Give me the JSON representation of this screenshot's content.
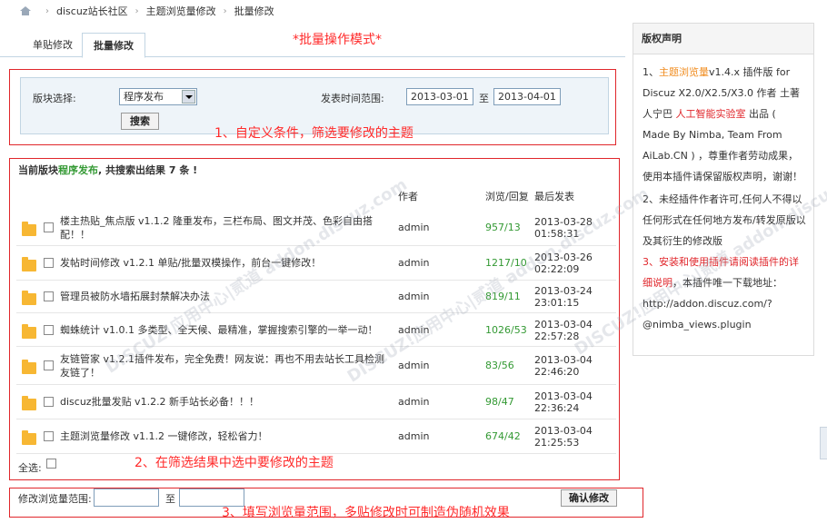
{
  "breadcrumb": [
    "discuz站长社区",
    "主题浏览量修改",
    "批量修改"
  ],
  "tabs": [
    "单贴修改",
    "批量修改"
  ],
  "mode_title": "*批量操作模式*",
  "filter": {
    "forum_label": "版块选择:",
    "forum_value": "程序发布",
    "date_label": "发表时间范围:",
    "date_from": "2013-03-01",
    "date_sep": "至",
    "date_to": "2013-04-01",
    "search_btn": "搜索"
  },
  "annotations": {
    "a1": "1、自定义条件，筛选要修改的主题",
    "a2": "2、在筛选结果中选中要修改的主题",
    "a3": "3、填写浏览量范围，多贴修改时可制造伪随机效果"
  },
  "results": {
    "prefix": "当前版块",
    "forum": "程序发布",
    "mid": ", 共搜索出结果 ",
    "count": "7",
    "suffix": " 条 !"
  },
  "columns": {
    "author": "作者",
    "stats": "浏览/回复",
    "last": "最后发表"
  },
  "rows": [
    {
      "title": "楼主热贴_焦点版 v1.1.2 隆重发布，三栏布局、图文并茂、色彩自由搭配！！",
      "author": "admin",
      "stats": "957/13",
      "date": "2013-03-28",
      "time": "01:58:31"
    },
    {
      "title": "发帖时间修改 v1.2.1 单贴/批量双模操作，前台一键修改！",
      "author": "admin",
      "stats": "1217/10",
      "date": "2013-03-26",
      "time": "02:22:09"
    },
    {
      "title": "管理员被防水墙拓展封禁解决办法",
      "author": "admin",
      "stats": "819/11",
      "date": "2013-03-24",
      "time": "23:01:15"
    },
    {
      "title": "蜘蛛统计 v1.0.1 多类型、全天候、最精准，掌握搜索引擎的一举一动！",
      "author": "admin",
      "stats": "1026/53",
      "date": "2013-03-04",
      "time": "22:57:28"
    },
    {
      "title": "友链管家 v1.2.1插件发布，完全免费！网友说：再也不用去站长工具检测友链了！",
      "author": "admin",
      "stats": "83/56",
      "date": "2013-03-04",
      "time": "22:46:20"
    },
    {
      "title": "discuz批量发贴 v1.2.2 新手站长必备！！！",
      "author": "admin",
      "stats": "98/47",
      "date": "2013-03-04",
      "time": "22:36:24"
    },
    {
      "title": "主题浏览量修改 v1.1.2 一键修改，轻松省力！",
      "author": "admin",
      "stats": "674/42",
      "date": "2013-03-04",
      "time": "21:25:53"
    }
  ],
  "select_all": "全选:",
  "views_range": {
    "label": "修改浏览量范围:",
    "sep": "至",
    "confirm_btn": "确认修改"
  },
  "sidebar": {
    "title": "版权声明",
    "p1_a": "1、",
    "p1_link": "主题浏览量",
    "p1_b": "v1.4.x 插件版 for Discuz X2.0/X2.5/X3.0 作者 土著人宁巴 ",
    "p1_lab": "人工智能实验室",
    "p1_c": " 出品 ( Made By Nimba, Team From AiLab.CN ) ，尊重作者劳动成果，使用本插件请保留版权声明，谢谢！",
    "p2": "2、未经插件作者许可,任何人不得以任何形式在任何地方发布/转发原版以及其衍生的修改版",
    "p3_red": "3、安装和使用插件请阅读插件的详细说明",
    "p3_b": "，本插件唯一下载地址：http://addon.discuz.com/?@nimba_views.plugin"
  },
  "watermark": "DISCUZ!应用中心|贰道 addon.discuz.com"
}
